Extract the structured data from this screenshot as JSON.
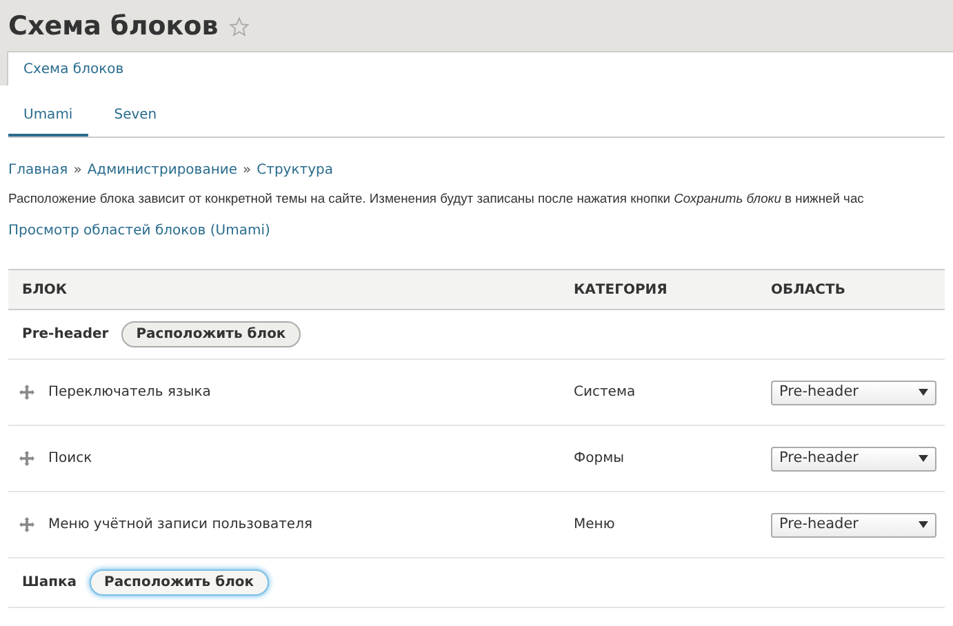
{
  "page_title": "Схема блоков",
  "primary_tabs": [
    {
      "label": "Схема блоков",
      "selected": true
    }
  ],
  "secondary_tabs": [
    {
      "label": "Umami",
      "selected": true
    },
    {
      "label": "Seven",
      "selected": false
    }
  ],
  "breadcrumb": [
    "Главная",
    "Администрирование",
    "Структура"
  ],
  "breadcrumb_separator": "»",
  "description": "Расположение блока зависит от конкретной темы на сайте. Изменения будут записаны после нажатия кнопки *Сохранить блоки* в нижней час",
  "demo_link": "Просмотр областей блоков (Umami)",
  "table": {
    "columns": [
      "БЛОК",
      "КАТЕГОРИЯ",
      "ОБЛАСТЬ"
    ],
    "rows": [
      {
        "kind": "region",
        "title": "Pre-header",
        "button": "Расположить блок",
        "focused": false
      },
      {
        "kind": "block",
        "name": "Переключатель языка",
        "category": "Система",
        "region": "Pre-header"
      },
      {
        "kind": "block",
        "name": "Поиск",
        "category": "Формы",
        "region": "Pre-header"
      },
      {
        "kind": "block",
        "name": "Меню учётной записи пользователя",
        "category": "Меню",
        "region": "Pre-header"
      },
      {
        "kind": "region",
        "title": "Шапка",
        "button": "Расположить блок",
        "focused": true
      }
    ]
  }
}
